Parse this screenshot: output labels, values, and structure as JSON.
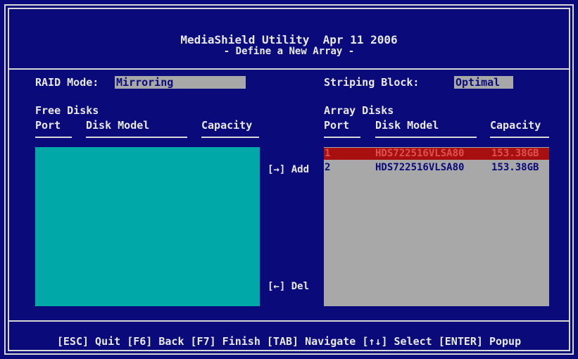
{
  "header": {
    "title": "MediaShield Utility  Apr 11 2006",
    "subtitle": "- Define a New Array -"
  },
  "raid_mode": {
    "label": "RAID Mode:",
    "value": "Mirroring"
  },
  "striping_block": {
    "label": "Striping Block:",
    "value": "Optimal"
  },
  "free_disks": {
    "heading": "Free Disks",
    "columns": [
      "Port",
      "Disk Model",
      "Capacity"
    ],
    "rows": []
  },
  "actions": {
    "add": "[→] Add",
    "del": "[←] Del"
  },
  "array_disks": {
    "heading": "Array Disks",
    "columns": [
      "Port",
      "Disk Model",
      "Capacity"
    ],
    "rows": [
      {
        "port": "1",
        "model": "HDS722516VLSA80",
        "capacity": "153.38GB",
        "selected": true
      },
      {
        "port": "2",
        "model": "HDS722516VLSA80",
        "capacity": "153.38GB",
        "selected": false
      }
    ]
  },
  "footer": {
    "help": "[ESC] Quit [F6] Back [F7] Finish [TAB] Navigate [↑↓] Select [ENTER] Popup"
  },
  "colors": {
    "background": "#0a0a7a",
    "free_panel": "#00a8a8",
    "array_panel": "#a8a8a8",
    "selected_row": "#a81010"
  }
}
